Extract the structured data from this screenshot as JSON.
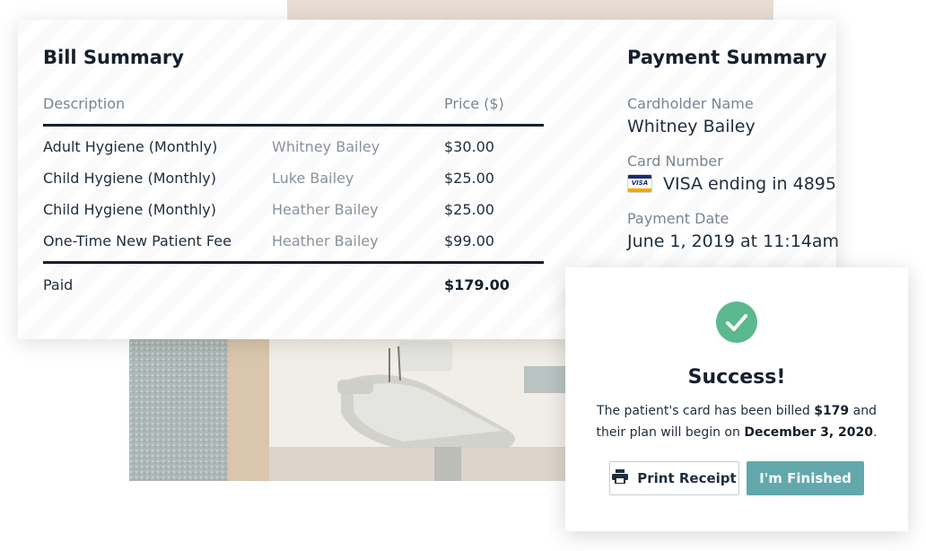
{
  "bill_summary": {
    "title": "Bill Summary",
    "col_description": "Description",
    "col_price": "Price ($)",
    "rows": [
      {
        "description": "Adult Hygiene (Monthly)",
        "patient": "Whitney Bailey",
        "price": "$30.00"
      },
      {
        "description": "Child Hygiene (Monthly)",
        "patient": "Luke Bailey",
        "price": "$25.00"
      },
      {
        "description": "Child Hygiene (Monthly)",
        "patient": "Heather Bailey",
        "price": "$25.00"
      },
      {
        "description": "One-Time New Patient Fee",
        "patient": "Heather Bailey",
        "price": "$99.00"
      }
    ],
    "paid_label": "Paid",
    "paid_total": "$179.00"
  },
  "payment_summary": {
    "title": "Payment Summary",
    "cardholder_label": "Cardholder Name",
    "cardholder_value": "Whitney Bailey",
    "card_number_label": "Card Number",
    "card_brand_badge": "VISA",
    "card_number_value": "VISA ending in 4895",
    "payment_date_label": "Payment Date",
    "payment_date_value": "June 1, 2019 at 11:14am"
  },
  "success_modal": {
    "title": "Success!",
    "msg_part1": "The patient's card has been billed ",
    "msg_amount": "$179",
    "msg_part2": " and their plan will begin on ",
    "msg_date": "December 3, 2020",
    "msg_part3": ".",
    "print_button": "Print Receipt",
    "finish_button": "I'm Finished",
    "icons": {
      "success": "check-circle-icon",
      "print": "printer-icon"
    }
  },
  "colors": {
    "accent_teal": "#62a8ac",
    "success_green": "#5cb88e",
    "visa_blue": "#1a2a6c",
    "visa_gold": "#f2a900"
  }
}
